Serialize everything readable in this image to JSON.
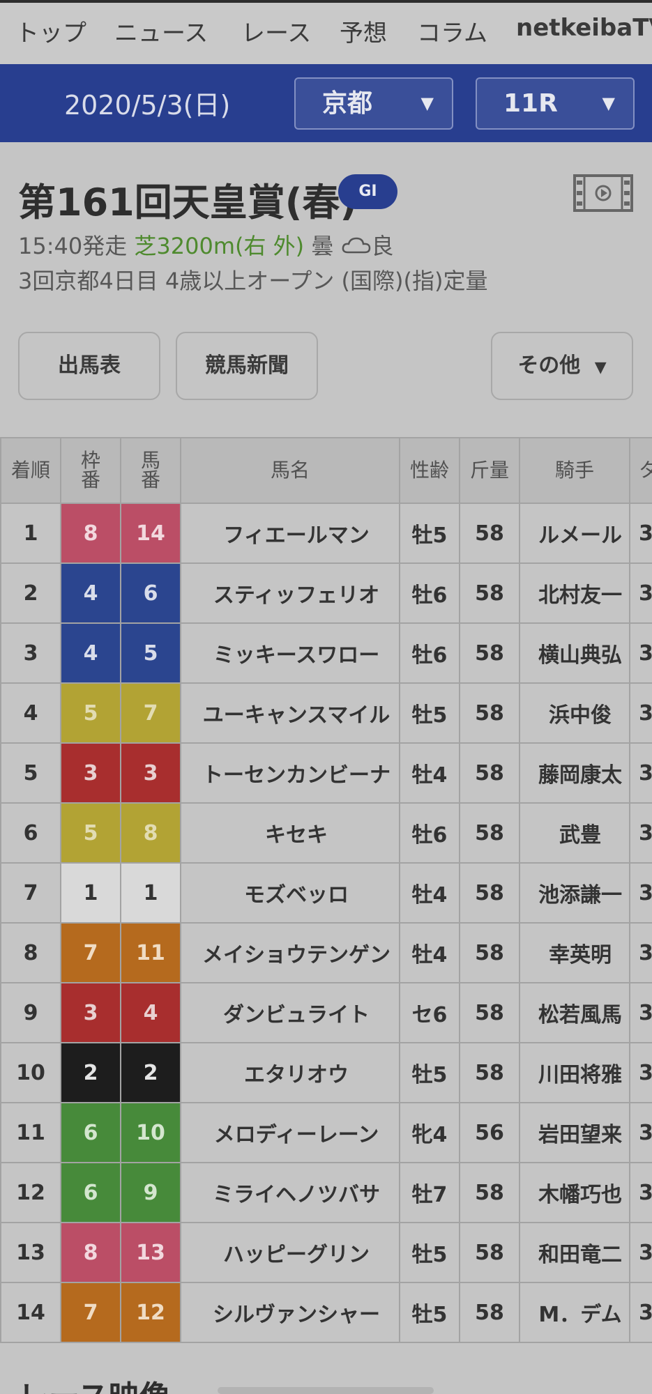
{
  "nav": {
    "items": [
      "トップ",
      "ニュース",
      "レース",
      "予想",
      "コラム",
      "netkeibaTV"
    ]
  },
  "race_header": {
    "date": "2020/5/3(日)",
    "venue_select": "京都",
    "race_select": "11R",
    "dropdown_arrow": "▼"
  },
  "race": {
    "title": "第161回天皇賞(春)",
    "grade": "GI",
    "start_time": "15:40発走",
    "course": "芝3200m(右 外)",
    "weather": "曇",
    "weather_icon": "cloud-icon",
    "ground": "良",
    "conditions": "3回京都4日目 4歳以上オープン (国際)(指)定量"
  },
  "buttons": {
    "card": "出馬表",
    "newspaper": "競馬新聞",
    "other": "その他"
  },
  "table": {
    "headers": {
      "rank": "着順",
      "frame": "枠\n番",
      "number": "馬\n番",
      "horse": "馬名",
      "sexage": "性齢",
      "weight": "斤量",
      "jockey": "騎手",
      "time": "タ"
    },
    "rows": [
      {
        "rank": "1",
        "frame": "8",
        "number": "14",
        "horse": "フィエールマン",
        "sexage": "牡5",
        "weight": "58",
        "jockey": "ルメール",
        "time": "3"
      },
      {
        "rank": "2",
        "frame": "4",
        "number": "6",
        "horse": "スティッフェリオ",
        "sexage": "牡6",
        "weight": "58",
        "jockey": "北村友一",
        "time": "3"
      },
      {
        "rank": "3",
        "frame": "4",
        "number": "5",
        "horse": "ミッキースワロー",
        "sexage": "牡6",
        "weight": "58",
        "jockey": "横山典弘",
        "time": "3"
      },
      {
        "rank": "4",
        "frame": "5",
        "number": "7",
        "horse": "ユーキャンスマイル",
        "sexage": "牡5",
        "weight": "58",
        "jockey": "浜中俊",
        "time": "3"
      },
      {
        "rank": "5",
        "frame": "3",
        "number": "3",
        "horse": "トーセンカンビーナ",
        "sexage": "牡4",
        "weight": "58",
        "jockey": "藤岡康太",
        "time": "3"
      },
      {
        "rank": "6",
        "frame": "5",
        "number": "8",
        "horse": "キセキ",
        "sexage": "牡6",
        "weight": "58",
        "jockey": "武豊",
        "time": "3"
      },
      {
        "rank": "7",
        "frame": "1",
        "number": "1",
        "horse": "モズベッロ",
        "sexage": "牡4",
        "weight": "58",
        "jockey": "池添謙一",
        "time": "3"
      },
      {
        "rank": "8",
        "frame": "7",
        "number": "11",
        "horse": "メイショウテンゲン",
        "sexage": "牡4",
        "weight": "58",
        "jockey": "幸英明",
        "time": "3"
      },
      {
        "rank": "9",
        "frame": "3",
        "number": "4",
        "horse": "ダンビュライト",
        "sexage": "セ6",
        "weight": "58",
        "jockey": "松若風馬",
        "time": "3"
      },
      {
        "rank": "10",
        "frame": "2",
        "number": "2",
        "horse": "エタリオウ",
        "sexage": "牡5",
        "weight": "58",
        "jockey": "川田将雅",
        "time": "3"
      },
      {
        "rank": "11",
        "frame": "6",
        "number": "10",
        "horse": "メロディーレーン",
        "sexage": "牝4",
        "weight": "56",
        "jockey": "岩田望来",
        "time": "3"
      },
      {
        "rank": "12",
        "frame": "6",
        "number": "9",
        "horse": "ミライヘノツバサ",
        "sexage": "牡7",
        "weight": "58",
        "jockey": "木幡巧也",
        "time": "3"
      },
      {
        "rank": "13",
        "frame": "8",
        "number": "13",
        "horse": "ハッピーグリン",
        "sexage": "牡5",
        "weight": "58",
        "jockey": "和田竜二",
        "time": "3"
      },
      {
        "rank": "14",
        "frame": "7",
        "number": "12",
        "horse": "シルヴァンシャー",
        "sexage": "牡5",
        "weight": "58",
        "jockey": "M．デム",
        "time": "3"
      }
    ]
  },
  "next_section": {
    "heading": "レース映像"
  }
}
